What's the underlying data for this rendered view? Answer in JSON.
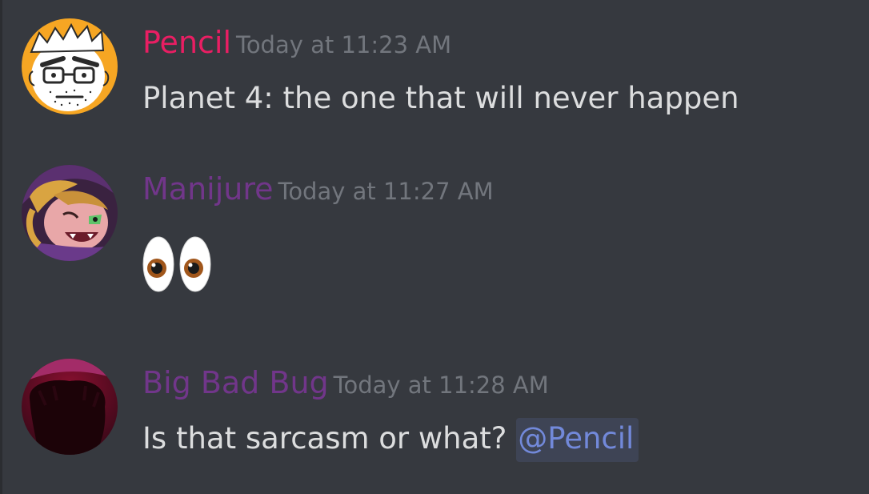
{
  "messages": [
    {
      "author": "Pencil",
      "author_color": "#e91e63",
      "timestamp": "Today at 11:23 AM",
      "text": "Planet 4: the one that will never happen"
    },
    {
      "author": "Manijure",
      "author_color": "#71368a",
      "timestamp": "Today at 11:27 AM",
      "emoji": "eyes-emoji"
    },
    {
      "author": "Big Bad Bug",
      "author_color": "#71368a",
      "timestamp": "Today at 11:28 AM",
      "text": "Is that sarcasm or what?",
      "mention": "@Pencil",
      "mention_color": "#7289da"
    }
  ]
}
